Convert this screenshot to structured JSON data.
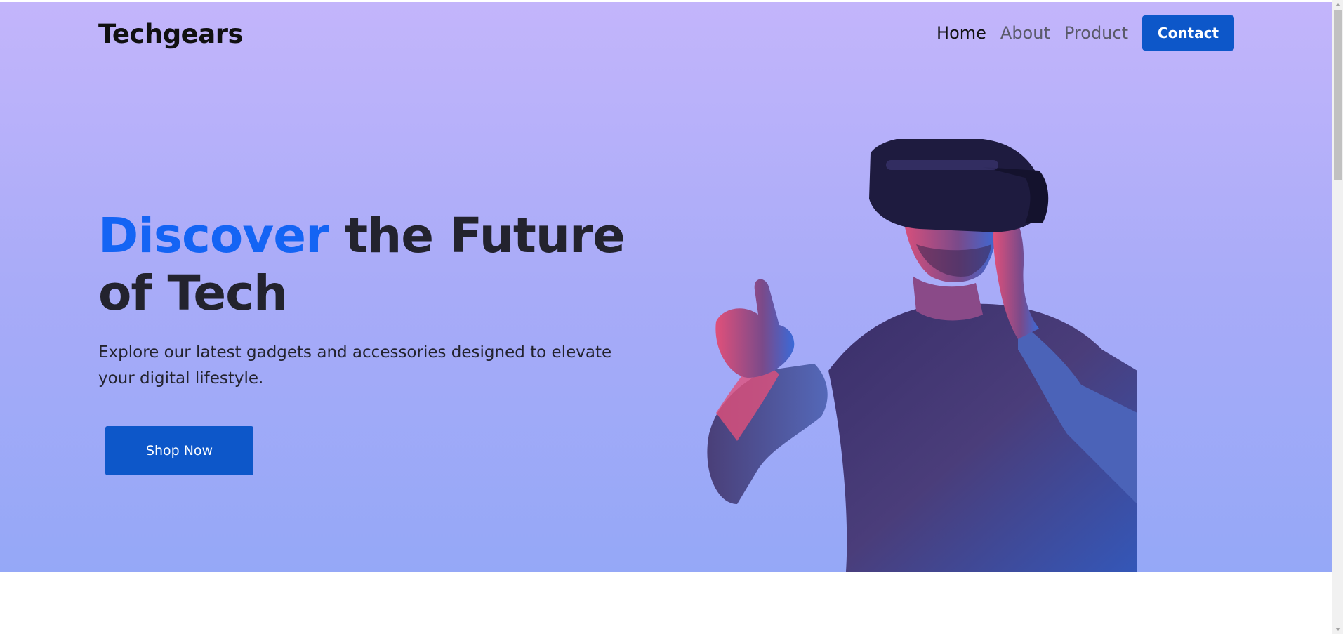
{
  "brand": {
    "name": "Techgears"
  },
  "nav": {
    "links": [
      {
        "label": "Home",
        "active": true
      },
      {
        "label": "About",
        "active": false
      },
      {
        "label": "Product",
        "active": false
      }
    ],
    "contact_label": "Contact"
  },
  "hero": {
    "title_accent": "Discover",
    "title_rest": " the Future of Tech",
    "description": "Explore our latest gadgets and accessories designed to elevate your digital lifestyle.",
    "cta_label": "Shop Now",
    "image_subject": "person-wearing-vr-headset"
  },
  "colors": {
    "accent": "#1464f4",
    "button": "#0d57c9",
    "hero_gradient_top": "#c3b5fb",
    "hero_gradient_bottom": "#95a8f7",
    "heading": "#23232e"
  }
}
